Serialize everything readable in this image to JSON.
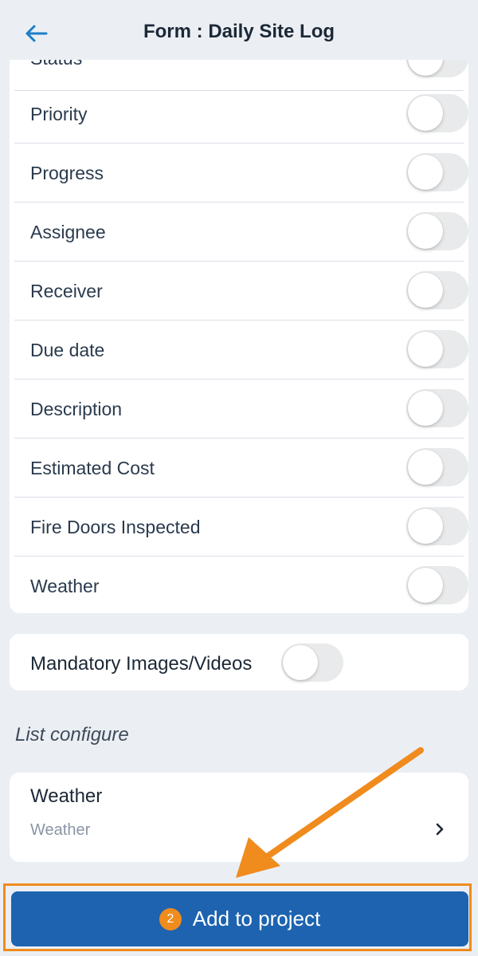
{
  "header": {
    "title": "Form : Daily Site Log"
  },
  "fields": [
    {
      "label": "Status",
      "enabled": false
    },
    {
      "label": "Priority",
      "enabled": false
    },
    {
      "label": "Progress",
      "enabled": false
    },
    {
      "label": "Assignee",
      "enabled": false
    },
    {
      "label": "Receiver",
      "enabled": false
    },
    {
      "label": "Due date",
      "enabled": false
    },
    {
      "label": "Description",
      "enabled": false
    },
    {
      "label": "Estimated Cost",
      "enabled": false
    },
    {
      "label": "Fire Doors Inspected",
      "enabled": false
    },
    {
      "label": "Weather",
      "enabled": false
    }
  ],
  "mandatory": {
    "label": "Mandatory Images/Videos",
    "enabled": false
  },
  "list_configure": {
    "section_title": "List configure",
    "item": {
      "title": "Weather",
      "subtitle": "Weather"
    }
  },
  "action": {
    "badge": "2",
    "label": "Add to project"
  },
  "colors": {
    "accent": "#1d63b0",
    "annotation": "#f08b1d",
    "background": "#ebeff4"
  },
  "icons": [
    "back-arrow-icon",
    "chevron-right-icon"
  ]
}
